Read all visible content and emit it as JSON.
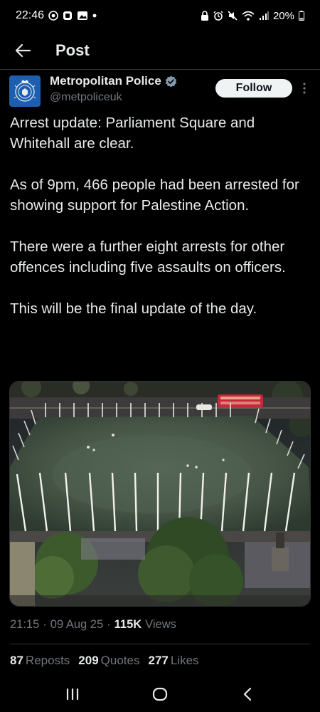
{
  "status_bar": {
    "time": "22:46",
    "battery": "20%",
    "left_icons": [
      "whatsapp-icon",
      "notification-icon",
      "gallery-icon",
      "dot-icon"
    ],
    "right_icons": [
      "lock-icon",
      "alarm-icon",
      "mute-icon",
      "wifi-icon",
      "signal-icon",
      "battery-icon"
    ]
  },
  "header": {
    "title": "Post"
  },
  "author": {
    "name": "Metropolitan Police",
    "handle": "@metpoliceuk",
    "verified": true,
    "follow_label": "Follow"
  },
  "tweet": {
    "paragraphs": [
      "Arrest update: Parliament Square and Whitehall are clear.",
      "As of 9pm, 466 people had been arrested for showing support for Palestine Action.",
      "There were a further eight arrests for other offences including five assaults on officers.",
      "This will be the final update of the day."
    ]
  },
  "meta": {
    "time": "21:15",
    "date": "09 Aug 25",
    "views_count": "115K",
    "views_label": "Views",
    "separator": "·"
  },
  "stats": {
    "reposts_count": "87",
    "reposts_label": "Reposts",
    "quotes_count": "209",
    "quotes_label": "Quotes",
    "likes_count": "277",
    "likes_label": "Likes"
  },
  "colors": {
    "background": "#000000",
    "text": "#e7e9ea",
    "secondary_text": "#71767b",
    "verified": "#829aab",
    "divider": "#2f3336",
    "avatar_bg": "#1d5fae"
  }
}
